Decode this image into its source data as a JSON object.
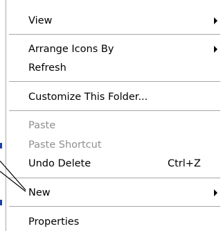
{
  "desktop": {
    "partial_text": "▪ ▯▯▯ ▯▯▯▯▯▯▯▯"
  },
  "context_menu": {
    "items": [
      {
        "label": "View",
        "submenu": true
      },
      {
        "label": "Arrange Icons By",
        "submenu": true
      },
      {
        "label": "Refresh"
      },
      {
        "label": "Customize This Folder..."
      },
      {
        "label": "Paste",
        "disabled": true
      },
      {
        "label": "Paste Shortcut",
        "disabled": true
      },
      {
        "label": "Undo Delete",
        "shortcut": "Ctrl+Z"
      },
      {
        "label": "New",
        "submenu": true
      },
      {
        "label": "Properties"
      }
    ]
  },
  "colors": {
    "separator": "#a6a6a6",
    "disabled_text": "#8f8f8f",
    "accent": "#1b3fa3"
  }
}
